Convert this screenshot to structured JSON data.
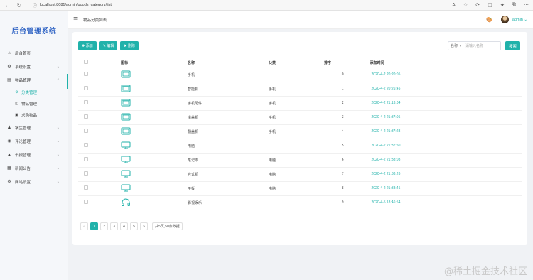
{
  "browser": {
    "url": "localhost:8081/admin/goods_category/list"
  },
  "sidebar": {
    "title": "后台管理系统",
    "items": [
      {
        "label": "后台首页",
        "icon": "home-icon",
        "arrow": false
      },
      {
        "label": "系统设置",
        "icon": "gear-icon",
        "arrow": true
      },
      {
        "label": "物品管理",
        "icon": "goods-icon",
        "arrow": true,
        "open": true,
        "children": [
          {
            "label": "分类管理",
            "icon": "category-icon",
            "active": true
          },
          {
            "label": "物品管理",
            "icon": "cart-icon",
            "active": false
          },
          {
            "label": "求购物品",
            "icon": "wanted-icon",
            "active": false
          }
        ]
      },
      {
        "label": "学生管理",
        "icon": "users-icon",
        "arrow": true
      },
      {
        "label": "评论管理",
        "icon": "comment-icon",
        "arrow": true
      },
      {
        "label": "举报管理",
        "icon": "warning-icon",
        "arrow": true
      },
      {
        "label": "新闻公告",
        "icon": "news-icon",
        "arrow": true
      },
      {
        "label": "网站设置",
        "icon": "site-settings-icon",
        "arrow": true
      }
    ]
  },
  "header": {
    "breadcrumb": "物品分类列表",
    "user": "admin"
  },
  "toolbar": {
    "add_label": "添加",
    "edit_label": "编辑",
    "delete_label": "删除"
  },
  "search": {
    "select_value": "名称",
    "placeholder": "请输入名称",
    "button": "搜索"
  },
  "table": {
    "headers": [
      "图标",
      "名称",
      "父类",
      "排序",
      "添加时间"
    ],
    "rows": [
      {
        "icon": "phone-icon",
        "name": "手机",
        "parent": "",
        "sort": "0",
        "time": "2020-4-2 20:20:05"
      },
      {
        "icon": "phone-icon",
        "name": "智能机",
        "parent": "手机",
        "sort": "1",
        "time": "2020-4-2 20:26:45"
      },
      {
        "icon": "phone-icon",
        "name": "手机配件",
        "parent": "手机",
        "sort": "2",
        "time": "2020-4-2 21:13:04"
      },
      {
        "icon": "phone-icon",
        "name": "滑盖机",
        "parent": "手机",
        "sort": "3",
        "time": "2020-4-2 21:37:05"
      },
      {
        "icon": "phone-icon",
        "name": "翻盖机",
        "parent": "手机",
        "sort": "4",
        "time": "2020-4-2 21:37:23"
      },
      {
        "icon": "monitor-icon",
        "name": "电脑",
        "parent": "",
        "sort": "5",
        "time": "2020-4-2 21:37:50"
      },
      {
        "icon": "monitor-icon",
        "name": "笔记本",
        "parent": "电脑",
        "sort": "6",
        "time": "2020-4-2 21:38:08"
      },
      {
        "icon": "monitor-icon",
        "name": "台式机",
        "parent": "电脑",
        "sort": "7",
        "time": "2020-4-2 21:38:26"
      },
      {
        "icon": "monitor-icon",
        "name": "平板",
        "parent": "电脑",
        "sort": "8",
        "time": "2020-4-2 21:38:45"
      },
      {
        "icon": "headphones-icon",
        "name": "影视娱乐",
        "parent": "",
        "sort": "9",
        "time": "2020-4-5 18:46:54"
      }
    ]
  },
  "pagination": {
    "prev": "«",
    "pages": [
      "1",
      "2",
      "3",
      "4",
      "5"
    ],
    "current": "1",
    "next": "»",
    "total": "共5页,50条数据"
  },
  "watermark": "@稀土掘金技术社区",
  "colors": {
    "accent": "#20b2aa",
    "brand": "#3064c4"
  }
}
